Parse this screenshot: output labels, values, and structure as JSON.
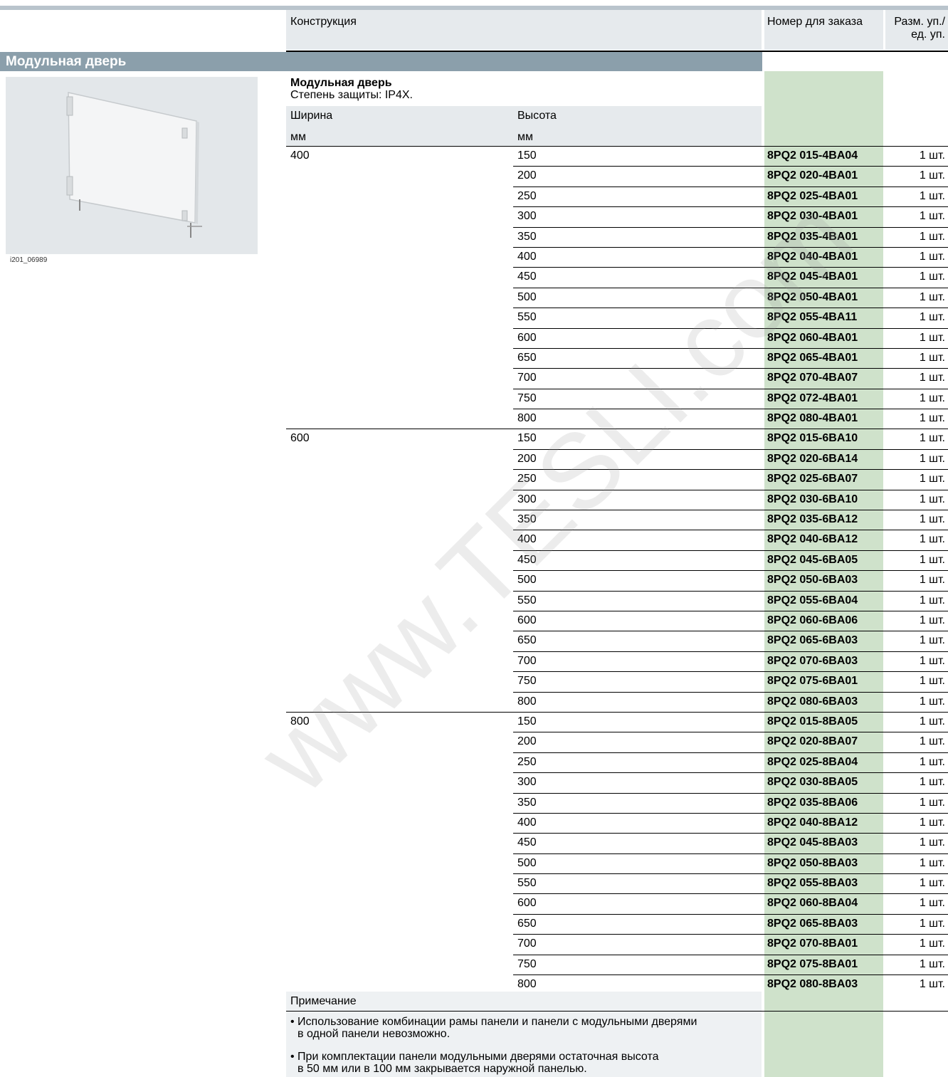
{
  "header": {
    "construction": "Конструкция",
    "order_number": "Номер для заказа",
    "pack_size_line1": "Разм. уп./",
    "pack_size_line2": "ед. уп."
  },
  "section_title": "Модульная дверь",
  "image_caption": "i201_06989",
  "product": {
    "title": "Модульная дверь",
    "protection": "Степень защиты: IP4X."
  },
  "columns": {
    "width_label": "Ширина",
    "width_unit": "мм",
    "height_label": "Высота",
    "height_unit": "мм"
  },
  "rows": [
    {
      "width": "400",
      "height": "150",
      "order": "8PQ2 015-4BA04",
      "pack": "1 шт."
    },
    {
      "width": "",
      "height": "200",
      "order": "8PQ2 020-4BA01",
      "pack": "1 шт."
    },
    {
      "width": "",
      "height": "250",
      "order": "8PQ2 025-4BA01",
      "pack": "1 шт."
    },
    {
      "width": "",
      "height": "300",
      "order": "8PQ2 030-4BA01",
      "pack": "1 шт."
    },
    {
      "width": "",
      "height": "350",
      "order": "8PQ2 035-4BA01",
      "pack": "1 шт."
    },
    {
      "width": "",
      "height": "400",
      "order": "8PQ2 040-4BA01",
      "pack": "1 шт."
    },
    {
      "width": "",
      "height": "450",
      "order": "8PQ2 045-4BA01",
      "pack": "1 шт."
    },
    {
      "width": "",
      "height": "500",
      "order": "8PQ2 050-4BA01",
      "pack": "1 шт."
    },
    {
      "width": "",
      "height": "550",
      "order": "8PQ2 055-4BA11",
      "pack": "1 шт."
    },
    {
      "width": "",
      "height": "600",
      "order": "8PQ2 060-4BA01",
      "pack": "1 шт."
    },
    {
      "width": "",
      "height": "650",
      "order": "8PQ2 065-4BA01",
      "pack": "1 шт."
    },
    {
      "width": "",
      "height": "700",
      "order": "8PQ2 070-4BA07",
      "pack": "1 шт."
    },
    {
      "width": "",
      "height": "750",
      "order": "8PQ2 072-4BA01",
      "pack": "1 шт."
    },
    {
      "width": "",
      "height": "800",
      "order": "8PQ2 080-4BA01",
      "pack": "1 шт."
    },
    {
      "width": "600",
      "height": "150",
      "order": "8PQ2 015-6BA10",
      "pack": "1 шт."
    },
    {
      "width": "",
      "height": "200",
      "order": "8PQ2 020-6BA14",
      "pack": "1 шт."
    },
    {
      "width": "",
      "height": "250",
      "order": "8PQ2 025-6BA07",
      "pack": "1 шт."
    },
    {
      "width": "",
      "height": "300",
      "order": "8PQ2 030-6BA10",
      "pack": "1 шт."
    },
    {
      "width": "",
      "height": "350",
      "order": "8PQ2 035-6BA12",
      "pack": "1 шт."
    },
    {
      "width": "",
      "height": "400",
      "order": "8PQ2 040-6BA12",
      "pack": "1 шт."
    },
    {
      "width": "",
      "height": "450",
      "order": "8PQ2 045-6BA05",
      "pack": "1 шт."
    },
    {
      "width": "",
      "height": "500",
      "order": "8PQ2 050-6BA03",
      "pack": "1 шт."
    },
    {
      "width": "",
      "height": "550",
      "order": "8PQ2 055-6BA04",
      "pack": "1 шт."
    },
    {
      "width": "",
      "height": "600",
      "order": "8PQ2 060-6BA06",
      "pack": "1 шт."
    },
    {
      "width": "",
      "height": "650",
      "order": "8PQ2 065-6BA03",
      "pack": "1 шт."
    },
    {
      "width": "",
      "height": "700",
      "order": "8PQ2 070-6BA03",
      "pack": "1 шт."
    },
    {
      "width": "",
      "height": "750",
      "order": "8PQ2 075-6BA01",
      "pack": "1 шт."
    },
    {
      "width": "",
      "height": "800",
      "order": "8PQ2 080-6BA03",
      "pack": "1 шт."
    },
    {
      "width": "800",
      "height": "150",
      "order": "8PQ2 015-8BA05",
      "pack": "1 шт."
    },
    {
      "width": "",
      "height": "200",
      "order": "8PQ2 020-8BA07",
      "pack": "1 шт."
    },
    {
      "width": "",
      "height": "250",
      "order": "8PQ2 025-8BA04",
      "pack": "1 шт."
    },
    {
      "width": "",
      "height": "300",
      "order": "8PQ2 030-8BA05",
      "pack": "1 шт."
    },
    {
      "width": "",
      "height": "350",
      "order": "8PQ2 035-8BA06",
      "pack": "1 шт."
    },
    {
      "width": "",
      "height": "400",
      "order": "8PQ2 040-8BA12",
      "pack": "1 шт."
    },
    {
      "width": "",
      "height": "450",
      "order": "8PQ2 045-8BA03",
      "pack": "1 шт."
    },
    {
      "width": "",
      "height": "500",
      "order": "8PQ2 050-8BA03",
      "pack": "1 шт."
    },
    {
      "width": "",
      "height": "550",
      "order": "8PQ2 055-8BA03",
      "pack": "1 шт."
    },
    {
      "width": "",
      "height": "600",
      "order": "8PQ2 060-8BA04",
      "pack": "1 шт."
    },
    {
      "width": "",
      "height": "650",
      "order": "8PQ2 065-8BA03",
      "pack": "1 шт."
    },
    {
      "width": "",
      "height": "700",
      "order": "8PQ2 070-8BA01",
      "pack": "1 шт."
    },
    {
      "width": "",
      "height": "750",
      "order": "8PQ2 075-8BA01",
      "pack": "1 шт."
    },
    {
      "width": "",
      "height": "800",
      "order": "8PQ2 080-8BA03",
      "pack": "1 шт."
    }
  ],
  "note": {
    "title": "Примечание",
    "items": [
      {
        "line1": "• Использование комбинации рамы панели и панели с модульными дверями",
        "line2": "в одной панели невозможно."
      },
      {
        "line1": "• При комплектации панели модульными дверями остаточная высота",
        "line2": "в 50 мм или в 100 мм закрывается наружной панелью."
      }
    ]
  },
  "watermark": "www.TESLI.com"
}
